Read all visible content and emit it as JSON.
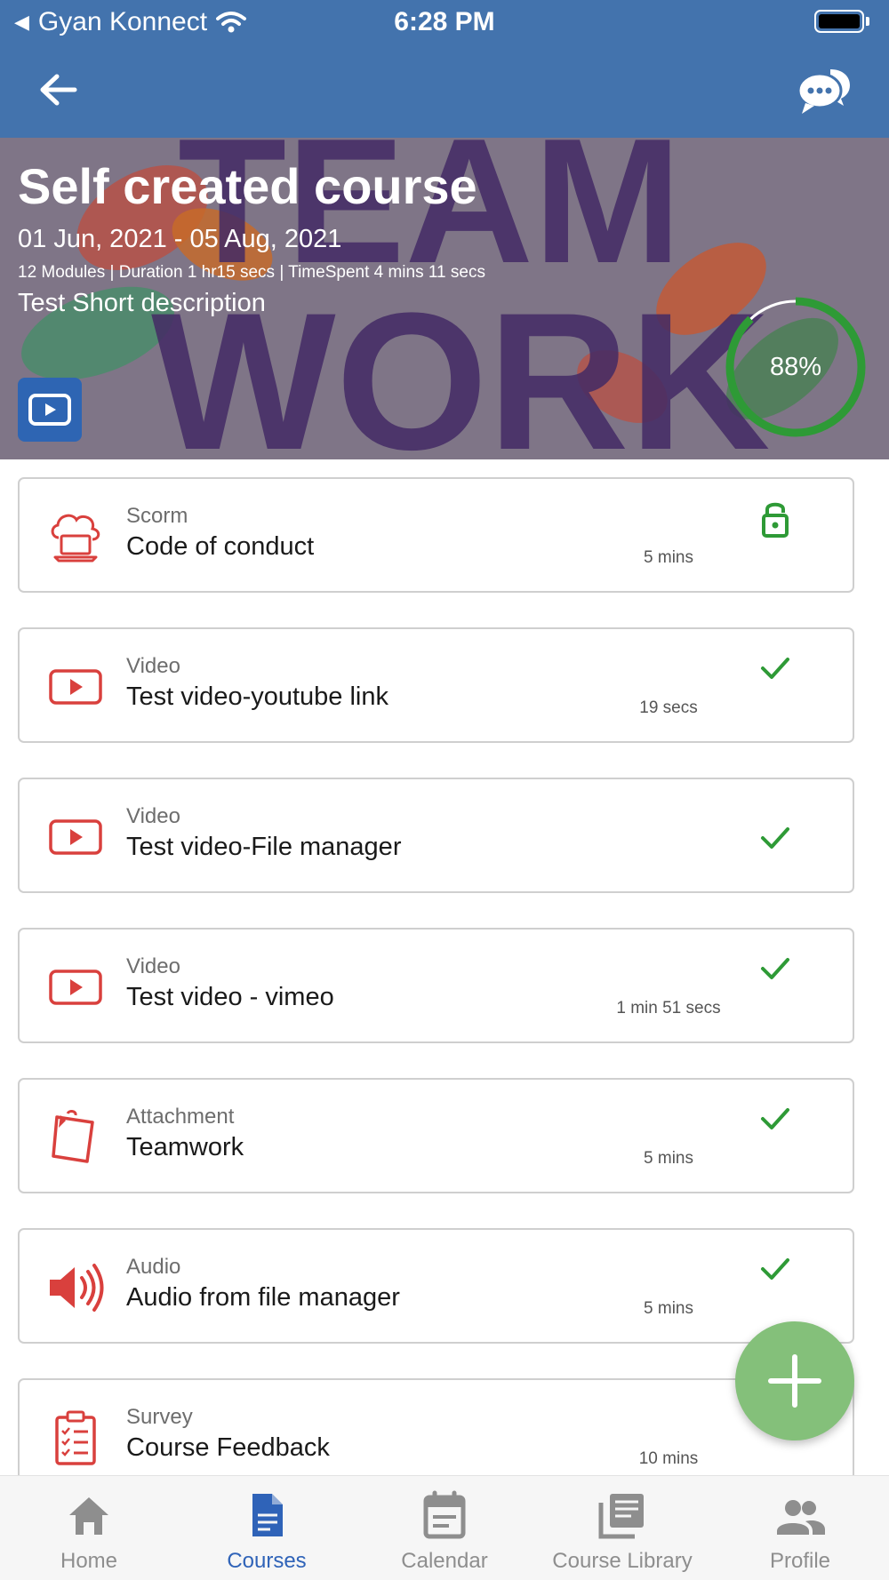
{
  "status_bar": {
    "carrier": "Gyan Konnect",
    "time": "6:28 PM"
  },
  "colors": {
    "header": "#4373ad",
    "accent_red": "#d9403d",
    "complete_green": "#2e9a36",
    "fab_green": "#84c07a",
    "nav_active": "#2f63b8",
    "nav_inactive": "#8e8e8e"
  },
  "course": {
    "title": "Self created course",
    "dates": "01 Jun, 2021 - 05 Aug, 2021",
    "meta": "12 Modules | Duration 1 hr15 secs | TimeSpent 4 mins 11 secs",
    "description": "Test Short description",
    "progress_percent": 88,
    "progress_label": "88%",
    "banner_art_text": "TEAM WORK"
  },
  "modules": [
    {
      "type": "Scorm",
      "name": "Code of conduct",
      "duration": "5 mins",
      "status": "locked",
      "icon": "cloud-laptop-icon"
    },
    {
      "type": "Video",
      "name": "Test video-youtube link",
      "duration": "19 secs",
      "status": "complete",
      "icon": "video-play-icon"
    },
    {
      "type": "Video",
      "name": "Test video-File manager",
      "duration": "",
      "status": "complete",
      "icon": "video-play-icon"
    },
    {
      "type": "Video",
      "name": "Test video - vimeo",
      "duration": "1 min 51 secs",
      "status": "complete",
      "icon": "video-play-icon"
    },
    {
      "type": "Attachment",
      "name": "Teamwork",
      "duration": "5 mins",
      "status": "complete",
      "icon": "clipboard-paper-icon"
    },
    {
      "type": "Audio",
      "name": "Audio from file manager",
      "duration": "5 mins",
      "status": "complete",
      "icon": "speaker-icon"
    },
    {
      "type": "Survey",
      "name": "Course Feedback",
      "duration": "10 mins",
      "status": "complete",
      "icon": "survey-checklist-icon"
    }
  ],
  "nav": {
    "items": [
      {
        "label": "Home",
        "icon": "home-icon",
        "active": false
      },
      {
        "label": "Courses",
        "icon": "document-icon",
        "active": true
      },
      {
        "label": "Calendar",
        "icon": "calendar-icon",
        "active": false
      },
      {
        "label": "Course Library",
        "icon": "library-icon",
        "active": false
      },
      {
        "label": "Profile",
        "icon": "people-icon",
        "active": false
      }
    ]
  }
}
